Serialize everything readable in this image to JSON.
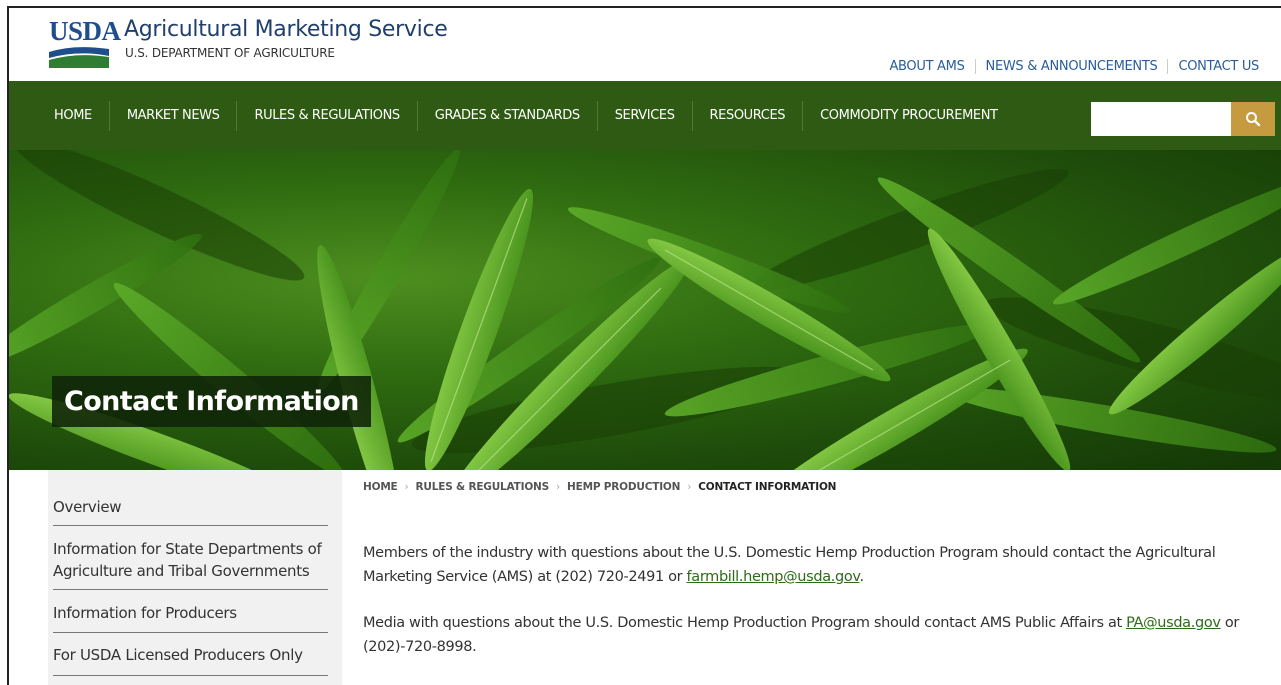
{
  "header": {
    "logo_text": "USDA",
    "title": "Agricultural Marketing Service",
    "subtitle": "U.S. DEPARTMENT OF AGRICULTURE",
    "utility_links": [
      "ABOUT AMS",
      "NEWS & ANNOUNCEMENTS",
      "CONTACT US"
    ]
  },
  "nav": {
    "items": [
      "HOME",
      "MARKET NEWS",
      "RULES & REGULATIONS",
      "GRADES & STANDARDS",
      "SERVICES",
      "RESOURCES",
      "COMMODITY PROCUREMENT"
    ],
    "search_placeholder": ""
  },
  "hero": {
    "title": "Contact Information"
  },
  "sidebar": {
    "items": [
      {
        "label": "Overview"
      },
      {
        "label": "Information for State Departments of Agriculture and Tribal Governments"
      },
      {
        "label": "Information for Producers"
      },
      {
        "label": "For USDA Licensed Producers Only"
      }
    ]
  },
  "breadcrumb": {
    "items": [
      "HOME",
      "RULES & REGULATIONS",
      "HEMP PRODUCTION"
    ],
    "current": "CONTACT INFORMATION"
  },
  "content": {
    "p1_text": "Members of the industry with questions about the U.S. Domestic Hemp Production Program should contact the Agricultural Marketing Service (AMS) at (202) 720-2491 or ",
    "p1_link": "farmbill.hemp@usda.gov",
    "p1_end": ".",
    "p2_text": "Media with questions about the U.S. Domestic Hemp Production Program should contact AMS Public Affairs at ",
    "p2_link": "PA@usda.gov",
    "p2_end": "  or (202)-720-8998."
  },
  "colors": {
    "nav_bg": "#2e5a13",
    "search_button": "#c69a3e",
    "link": "#2e6a1a",
    "brand_blue": "#1f4e8c"
  }
}
